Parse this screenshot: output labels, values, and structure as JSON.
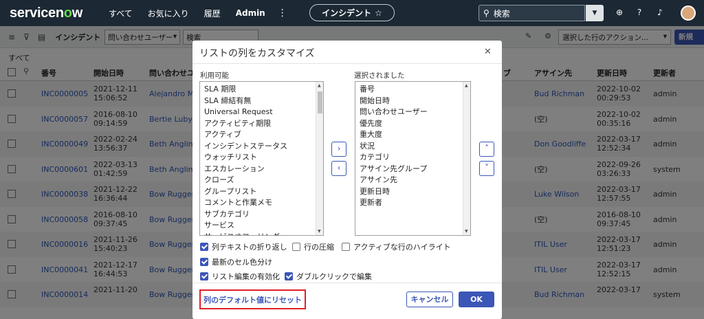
{
  "nav": {
    "logo_pre": "servicen",
    "logo_o": "o",
    "logo_post": "w",
    "links": [
      "すべて",
      "お気に入り",
      "履歴",
      "Admin"
    ],
    "more": "⋮",
    "incident_pill": "インシデント",
    "search_placeholder": "検索"
  },
  "toolbar": {
    "title": "インシデント",
    "filter_select": "問い合わせユーザー",
    "search_text": "検索",
    "action_select": "選択した行のアクション...",
    "new_label": "新規"
  },
  "breadcrumb_all": "すべて",
  "table": {
    "headers": [
      "番号",
      "開始日時",
      "問い合わせユ",
      "ブ",
      "アサイン先",
      "更新日時",
      "更新者"
    ],
    "rows": [
      {
        "number": "INC0000005",
        "opened_d": "2021-12-11",
        "opened_t": "15:06:52",
        "caller": "Alejandro Ma",
        "assigned": "Bud Richman",
        "updated_d": "2022-10-02",
        "updated_t": "00:29:53",
        "updated_by": "admin"
      },
      {
        "number": "INC0000057",
        "opened_d": "2016-08-10",
        "opened_t": "09:14:59",
        "caller": "Bertie Luby",
        "assigned": "(空)",
        "updated_d": "2022-10-02",
        "updated_t": "00:35:16",
        "updated_by": "admin"
      },
      {
        "number": "INC0000049",
        "opened_d": "2022-02-24",
        "opened_t": "13:56:37",
        "caller": "Beth Anglin",
        "assigned": "Don Goodliffe",
        "updated_d": "2022-03-17",
        "updated_t": "12:52:34",
        "updated_by": "admin"
      },
      {
        "number": "INC0000601",
        "opened_d": "2022-03-13",
        "opened_t": "01:42:59",
        "caller": "Beth Anglin",
        "assigned": "(空)",
        "updated_d": "2022-09-26",
        "updated_t": "03:26:33",
        "updated_by": "system"
      },
      {
        "number": "INC0000038",
        "opened_d": "2021-12-22",
        "opened_t": "16:36:44",
        "caller": "Bow Ruggeri",
        "assigned": "Luke Wilson",
        "updated_d": "2022-03-17",
        "updated_t": "12:57:55",
        "updated_by": "admin"
      },
      {
        "number": "INC0000058",
        "opened_d": "2016-08-10",
        "opened_t": "09:37:45",
        "caller": "Bow Ruggeri",
        "assigned": "(空)",
        "updated_d": "2016-08-10",
        "updated_t": "09:37:45",
        "updated_by": "admin"
      },
      {
        "number": "INC0000016",
        "opened_d": "2021-11-26",
        "opened_t": "15:40:23",
        "caller": "Bow Ruggeri",
        "assigned": "ITIL User",
        "updated_d": "2022-03-17",
        "updated_t": "12:51:23",
        "updated_by": "admin"
      },
      {
        "number": "INC0000041",
        "opened_d": "2021-12-17",
        "opened_t": "16:44:53",
        "caller": "Bow Ruggeri",
        "assigned": "ITIL User",
        "updated_d": "2022-03-17",
        "updated_t": "12:52:15",
        "updated_by": "admin"
      },
      {
        "number": "INC0000014",
        "opened_d": "2021-11-20",
        "opened_t": "",
        "caller": "Bow Ruggeri",
        "assigned": "Bud Richman",
        "updated_d": "2022-03-17",
        "updated_t": "",
        "updated_by": "system"
      }
    ]
  },
  "modal": {
    "title": "リストの列をカスタマイズ",
    "available_label": "利用可能",
    "selected_label": "選択されました",
    "available": [
      "SLA 期限",
      "SLA 締結有無",
      "Universal Request",
      "アクティビティ期限",
      "アクティブ",
      "インシデントステータス",
      "ウォッチリスト",
      "エスカレーション",
      "クローズ",
      "グループリスト",
      "コメントと作業メモ",
      "サブカテゴリ",
      "サービス",
      "サービスオファリング"
    ],
    "selected": [
      "番号",
      "開始日時",
      "問い合わせユーザー",
      "優先度",
      "重大度",
      "状況",
      "カテゴリ",
      "アサイン先グループ",
      "アサイン先",
      "更新日時",
      "更新者"
    ],
    "options": {
      "wrap": "列テキストの折り返し",
      "compact": "行の圧縮",
      "highlight": "アクティブな行のハイライト",
      "color": "最新のセル色分け",
      "list_edit": "リスト編集の有効化",
      "dblclick": "ダブルクリックで編集"
    },
    "reset": "列のデフォルト値にリセット",
    "cancel": "キャンセル",
    "ok": "OK"
  },
  "colors": {
    "nav_bg": "#1c2833",
    "primary": "#3b56b7",
    "link": "#2d57b8",
    "highlight_border": "#e0202a"
  }
}
